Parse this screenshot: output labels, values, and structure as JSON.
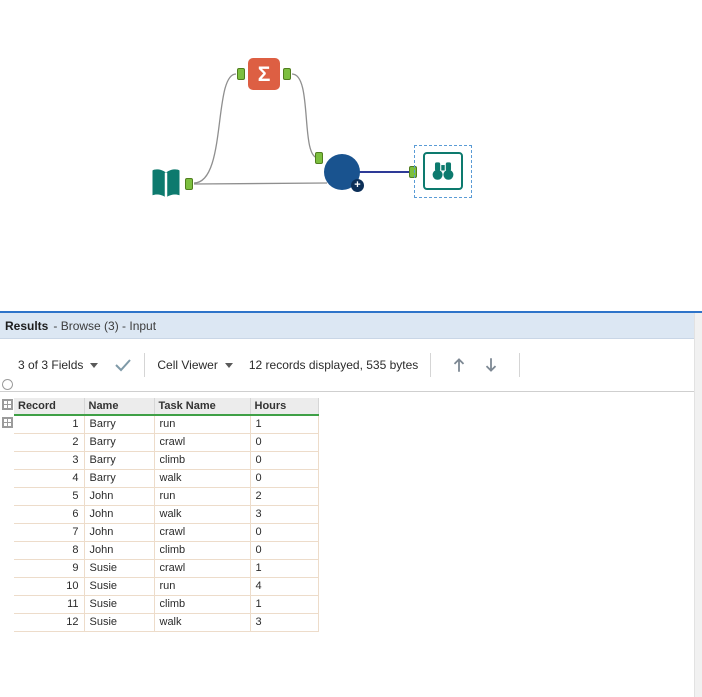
{
  "canvas": {
    "summarize_glyph": "Σ",
    "plus_badge_glyph": "+"
  },
  "results": {
    "title": "Results",
    "subtitle": "- Browse (3) - Input",
    "toolbar": {
      "fields_label": "3 of 3 Fields",
      "cell_viewer_label": "Cell Viewer",
      "records_label": "12 records displayed, 535 bytes"
    },
    "table": {
      "columns": [
        "Record",
        "Name",
        "Task Name",
        "Hours"
      ],
      "rows": [
        [
          "1",
          "Barry",
          "run",
          "1"
        ],
        [
          "2",
          "Barry",
          "crawl",
          "0"
        ],
        [
          "3",
          "Barry",
          "climb",
          "0"
        ],
        [
          "4",
          "Barry",
          "walk",
          "0"
        ],
        [
          "5",
          "John",
          "run",
          "2"
        ],
        [
          "6",
          "John",
          "walk",
          "3"
        ],
        [
          "7",
          "John",
          "crawl",
          "0"
        ],
        [
          "8",
          "John",
          "climb",
          "0"
        ],
        [
          "9",
          "Susie",
          "crawl",
          "1"
        ],
        [
          "10",
          "Susie",
          "run",
          "4"
        ],
        [
          "11",
          "Susie",
          "climb",
          "1"
        ],
        [
          "12",
          "Susie",
          "walk",
          "3"
        ]
      ]
    }
  },
  "colors": {
    "teal": "#0d7a6e",
    "orange": "#dd5f43",
    "blue_tool": "#19538f",
    "selection_blue": "#5a9bd5",
    "anchor_green": "#7cbf3f",
    "header_green": "#3fa046",
    "results_accent": "#2e74c9"
  }
}
